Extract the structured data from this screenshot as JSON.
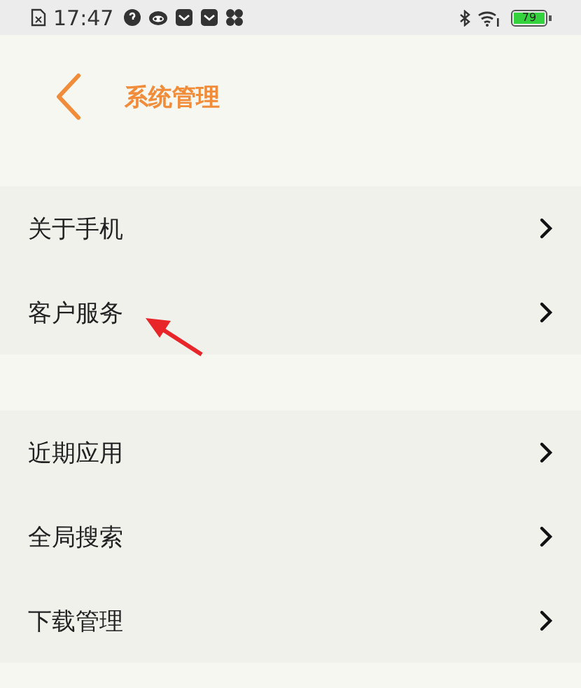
{
  "status_bar": {
    "time": "17:47",
    "battery": "79"
  },
  "header": {
    "title": "系统管理"
  },
  "groups": [
    {
      "items": [
        {
          "label": "关于手机"
        },
        {
          "label": "客户服务",
          "annotated": true
        }
      ]
    },
    {
      "items": [
        {
          "label": "近期应用"
        },
        {
          "label": "全局搜索"
        },
        {
          "label": "下载管理"
        }
      ]
    }
  ]
}
